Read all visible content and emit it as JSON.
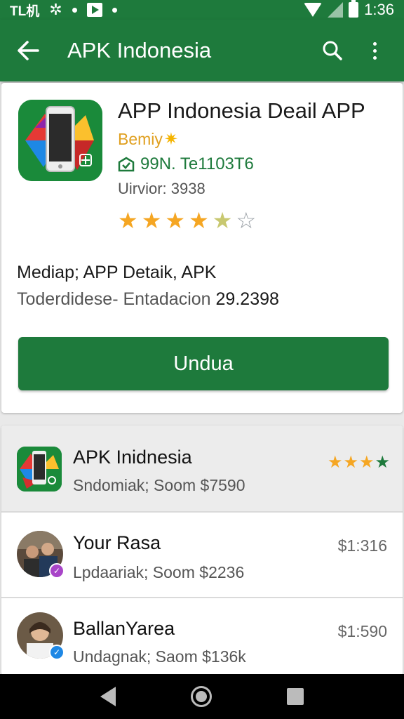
{
  "status_bar": {
    "left_text": "TL机",
    "time": "1:36"
  },
  "app_bar": {
    "title": "APK Indonesia"
  },
  "detail": {
    "title": "APP Indonesia Deail APP",
    "developer": "Bemiy",
    "version_code": "99N. Te1103T6",
    "version_label": "Uirvior: 3938",
    "rating": 4.5,
    "rating_max": 5,
    "description_line1": "Mediap; APP Detaik, APK",
    "description_line2_prefix": "Toderdidese- Entadacion",
    "description_line2_value": "29.2398",
    "install_label": "Undua",
    "accent_color": "#1e7a3c"
  },
  "list": {
    "items": [
      {
        "title": "APK Inidnesia",
        "subtitle": "Sndomiak; Soom $7590",
        "rating": 3.5
      },
      {
        "title": "Your Rasa",
        "subtitle": "Lpdaariak; Soom $2236",
        "price": "$1:316"
      },
      {
        "title": "BallanYarea",
        "subtitle": "Undagnak; Saom $136k",
        "price": "$1:590"
      }
    ]
  }
}
